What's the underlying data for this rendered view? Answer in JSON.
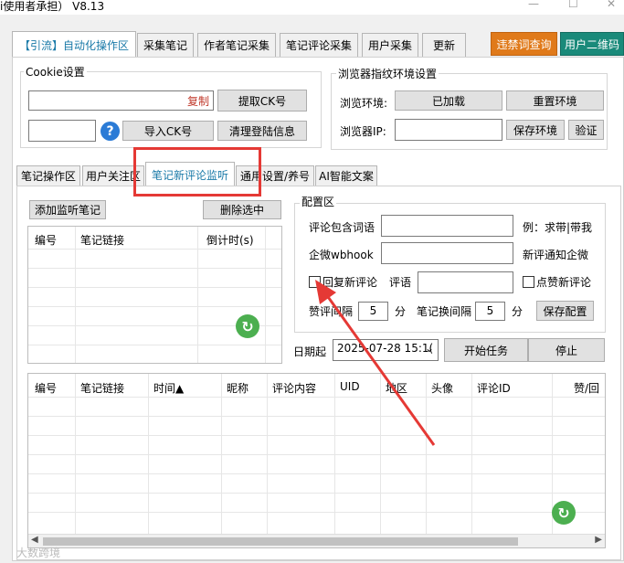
{
  "window": {
    "title_fragment": "i使用者承担）  V8.13"
  },
  "main_tabs": [
    "【引流】自动化操作区",
    "采集笔记",
    "作者笔记采集",
    "笔记评论采集",
    "用户采集",
    "更新"
  ],
  "top_right_buttons": {
    "banned_words": "违禁词查询",
    "user_qr": "用户二维码"
  },
  "cookie": {
    "group_title": "Cookie设置",
    "copy_link": "复制",
    "extract_ck": "提取CK号",
    "help_icon": "?",
    "import_ck": "导入CK号",
    "clear_login": "清理登陆信息",
    "input_value": ""
  },
  "browser": {
    "group_title": "浏览器指纹环境设置",
    "env_label": "浏览环境:",
    "env_status": "已加载",
    "reset_env": "重置环境",
    "ip_label": "浏览器IP:",
    "ip_value": "",
    "save_env": "保存环境",
    "verify": "验证"
  },
  "sub_tabs": [
    "笔记操作区",
    "用户关注区",
    "笔记新评论监听",
    "通用设置/养号",
    "AI智能文案"
  ],
  "monitor": {
    "add_btn": "添加监听笔记",
    "delete_btn": "删除选中",
    "columns": [
      "编号",
      "笔记链接",
      "倒计时(s)"
    ]
  },
  "config": {
    "group_title": "配置区",
    "keyword_label": "评论包含词语",
    "keyword_value": "",
    "keyword_example": "例：求带|带我",
    "webhook_label": "企微wbhook",
    "webhook_value": "",
    "webhook_hint": "新评通知企微",
    "reply_label": "回复新评论",
    "reply_text_label": "评语",
    "reply_text_value": "",
    "like_label": "点赞新评论",
    "like_interval_label": "赞评间隔",
    "like_interval_value": "5",
    "like_interval_unit": "分",
    "switch_interval_label": "笔记换间隔",
    "switch_interval_value": "5",
    "switch_interval_unit": "分",
    "save_btn": "保存配置"
  },
  "task": {
    "date_label": "日期起",
    "date_value": "2025-07-28 15:1(",
    "start_btn": "开始任务",
    "stop_btn": "停止"
  },
  "results": {
    "columns": [
      "编号",
      "笔记链接",
      "时间▲",
      "昵称",
      "评论内容",
      "UID",
      "地区",
      "头像",
      "评论ID",
      "赞/回"
    ]
  },
  "refresh_icon": "↻",
  "watermark": "大数跨境",
  "colors": {
    "accent_orange": "#e07a1a",
    "accent_teal": "#1a8a7a",
    "tab_text_active": "#1a7aa8",
    "highlight_red": "#e53935",
    "refresh_green": "#4caf50"
  }
}
